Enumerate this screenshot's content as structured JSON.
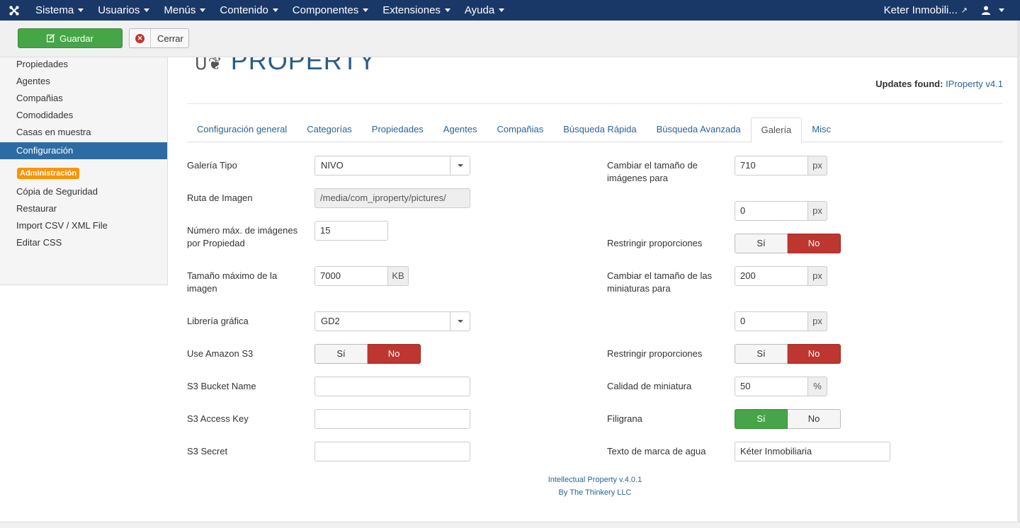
{
  "nav": {
    "items": [
      "Sistema",
      "Usuarios",
      "Menús",
      "Contenido",
      "Componentes",
      "Extensiones",
      "Ayuda"
    ],
    "site_name": "Keter Inmobili...",
    "brand_color": "#1a3867"
  },
  "toolbar": {
    "save_label": "Guardar",
    "close_label": "Cerrar"
  },
  "sidebar": {
    "items": [
      "Propiedades",
      "Agentes",
      "Compañias",
      "Comodidades",
      "Casas en muestra",
      "Configuración"
    ],
    "active": "Configuración",
    "badge": "Administración",
    "admin_items": [
      "Cópia de Seguridad",
      "Restaurar",
      "Import CSV / XML File",
      "Editar CSS"
    ]
  },
  "header": {
    "logo_text": "PROPERTY",
    "updates_label": "Updates found:",
    "updates_link": "IProperty v4.1"
  },
  "tabs": [
    "Configuración general",
    "Categorías",
    "Propiedades",
    "Agentes",
    "Compañias",
    "Búsqueda Rápida",
    "Búsqueda Avanzada",
    "Galería",
    "Misc"
  ],
  "active_tab": "Galería",
  "form_left": {
    "gallery_type_label": "Galería Tipo",
    "gallery_type_value": "NIVO",
    "image_path_label": "Ruta de Imagen",
    "image_path_value": "/media/com_iproperty/pictures/",
    "max_images_label": "Número máx. de imágenes por Propiedad",
    "max_images_value": "15",
    "max_size_label": "Tamaño máximo de la imagen",
    "max_size_value": "7000",
    "max_size_unit": "KB",
    "graphics_lib_label": "Librería gráfica",
    "graphics_lib_value": "GD2",
    "amazon_label": "Use Amazon S3",
    "yes": "Sí",
    "no": "No",
    "bucket_label": "S3 Bucket Name",
    "bucket_value": "",
    "access_label": "S3 Access Key",
    "access_value": "",
    "secret_label": "S3 Secret",
    "secret_value": ""
  },
  "form_right": {
    "resize_label": "Cambiar el tamaño de imágenes para",
    "resize_w": "710",
    "resize_h": "0",
    "unit_px": "px",
    "restrict_label": "Restringir proporciones",
    "thumb_resize_label": "Cambiar el tamaño de las miniaturas para",
    "thumb_w": "200",
    "thumb_h": "0",
    "restrict2_label": "Restringir proporciones",
    "quality_label": "Calidad de miniatura",
    "quality_value": "50",
    "quality_unit": "%",
    "watermark_label": "Filigrana",
    "watermark_text_label": "Texto de marca de agua",
    "watermark_text_value": "Kéter Inmobiliaria"
  },
  "footer": {
    "line1": "Intellectual Property v.4.0.1",
    "line2": "By The Thinkery LLC"
  }
}
